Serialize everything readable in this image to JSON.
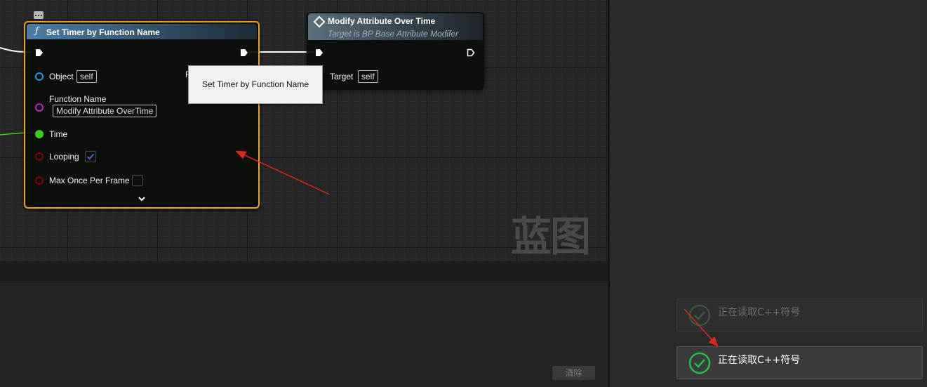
{
  "graph": {
    "watermark": "蓝图"
  },
  "set_timer_node": {
    "title": "Set Timer by Function Name",
    "icon": "function-icon",
    "pins": {
      "object_label": "Object",
      "object_value": "self",
      "function_name_label": "Function Name",
      "function_name_value": "Modify Attribute OverTime",
      "time_label": "Time",
      "looping_label": "Looping",
      "looping_checked": true,
      "max_once_label": "Max Once Per Frame",
      "max_once_checked": false
    },
    "expand_icon": "chevron-down-icon",
    "comment_icon": "comment-bubble-icon"
  },
  "modify_node": {
    "title": "Modify Attribute Over Time",
    "subtitle": "Target is BP Base Attribute Modifer",
    "icon": "event-diamond-icon",
    "pins": {
      "target_label": "Target",
      "target_value": "self"
    }
  },
  "tooltip": {
    "text": "Set Timer by Function Name",
    "partial_label": "R"
  },
  "notifications": [
    {
      "text": "正在读取C++符号",
      "faded": true,
      "icon": "check-circle-icon"
    },
    {
      "text": "正在读取C++符号",
      "faded": false,
      "icon": "check-circle-icon"
    }
  ],
  "bottom_panel": {
    "clear_label": "清除"
  },
  "colors": {
    "selection_outline": "#f0a21e",
    "object_pin": "#1e9fe6",
    "name_pin": "#c91fc9",
    "float_pin": "#3acf1c",
    "bool_pin": "#8c0000",
    "success_green": "#22c04a",
    "annotation_arrow": "#e0261c"
  }
}
